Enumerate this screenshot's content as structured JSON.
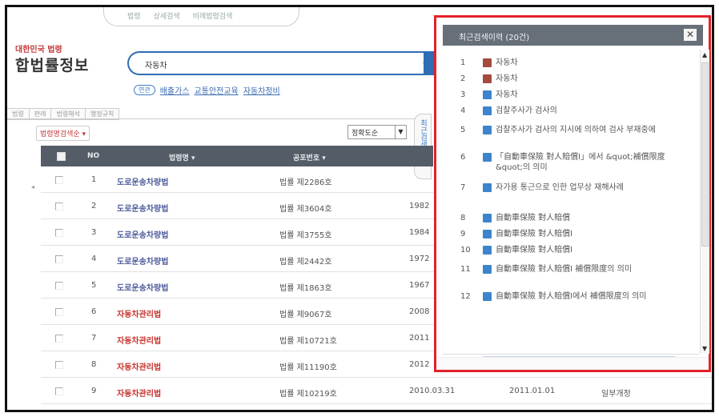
{
  "top_nav": {
    "items": [
      "법령",
      "상세검색",
      "비례법령검색"
    ]
  },
  "brand": {
    "sub": "대한민국 법령",
    "title": "합법률정보"
  },
  "search": {
    "value": "자동차"
  },
  "related": {
    "label": "연관",
    "links": [
      "배출가스",
      "교통안전교육",
      "자동차정비"
    ]
  },
  "tabs": [
    "법령",
    "판례",
    "법령해석",
    "행정규칙"
  ],
  "toolbar": {
    "sort_button": "법령명검색순 ▾",
    "select_value": "정확도순"
  },
  "side_tab": {
    "label": "최근검색어"
  },
  "table": {
    "headers": {
      "no": "NO",
      "name": "법령명 ▾",
      "number": "공포번호 ▾"
    },
    "rows": [
      {
        "no": "1",
        "name": "도로운송차량법",
        "style": "blue",
        "number": "법률 제2286호",
        "prom": "",
        "eff": "",
        "kind": ""
      },
      {
        "no": "2",
        "name": "도로운송차량법",
        "style": "blue",
        "number": "법률 제3604호",
        "prom": "1982",
        "eff": "",
        "kind": ""
      },
      {
        "no": "3",
        "name": "도로운송차량법",
        "style": "blue",
        "number": "법률 제3755호",
        "prom": "1984",
        "eff": "",
        "kind": ""
      },
      {
        "no": "4",
        "name": "도로운송차량법",
        "style": "blue",
        "number": "법률 제2442호",
        "prom": "1972",
        "eff": "",
        "kind": ""
      },
      {
        "no": "5",
        "name": "도로운송차량법",
        "style": "blue",
        "number": "법률 제1863호",
        "prom": "1967",
        "eff": "",
        "kind": ""
      },
      {
        "no": "6",
        "name": "자동차관리법",
        "style": "red",
        "number": "법률 제9067호",
        "prom": "2008",
        "eff": "",
        "kind": ""
      },
      {
        "no": "7",
        "name": "자동차관리법",
        "style": "red",
        "number": "법률 제10721호",
        "prom": "2011",
        "eff": "",
        "kind": ""
      },
      {
        "no": "8",
        "name": "자동차관리법",
        "style": "red",
        "number": "법률 제11190호",
        "prom": "2012",
        "eff": "",
        "kind": ""
      },
      {
        "no": "9",
        "name": "자동차관리법",
        "style": "red",
        "number": "법률 제10219호",
        "prom": "2010.03.31",
        "eff": "2011.01.01",
        "kind": "일부개정"
      }
    ]
  },
  "recent_panel": {
    "title": "최근검색이력 (20건)",
    "items": [
      {
        "n": "1",
        "color": "red",
        "text": "자동차"
      },
      {
        "n": "2",
        "color": "red",
        "text": "자동차"
      },
      {
        "n": "3",
        "color": "blue",
        "text": "자동차"
      },
      {
        "n": "4",
        "color": "blue",
        "text": "검찰주사가 검사의"
      },
      {
        "n": "5",
        "color": "blue",
        "text": "검찰주사가 검사의 지시에 의하여 검사 부재중에"
      },
      {
        "n": "6",
        "color": "blue",
        "text": "「自動車保險 對人賠償Ⅰ」에서 &quot;補償限度&quot;의 의미"
      },
      {
        "n": "7",
        "color": "blue",
        "text": "자가용 통근으로 인한 업무상 재해사례"
      },
      {
        "n": "8",
        "color": "blue",
        "text": "自動車保險 對人賠償"
      },
      {
        "n": "9",
        "color": "blue",
        "text": "自動車保險 對人賠償Ⅰ"
      },
      {
        "n": "10",
        "color": "blue",
        "text": "自動車保險 對人賠償Ⅰ"
      },
      {
        "n": "11",
        "color": "blue",
        "text": "自動車保險 對人賠償Ⅰ 補償限度의 의미"
      },
      {
        "n": "12",
        "color": "blue",
        "text": "自動車保險 對人賠償Ⅰ에서 補償限度의 의미"
      }
    ]
  }
}
